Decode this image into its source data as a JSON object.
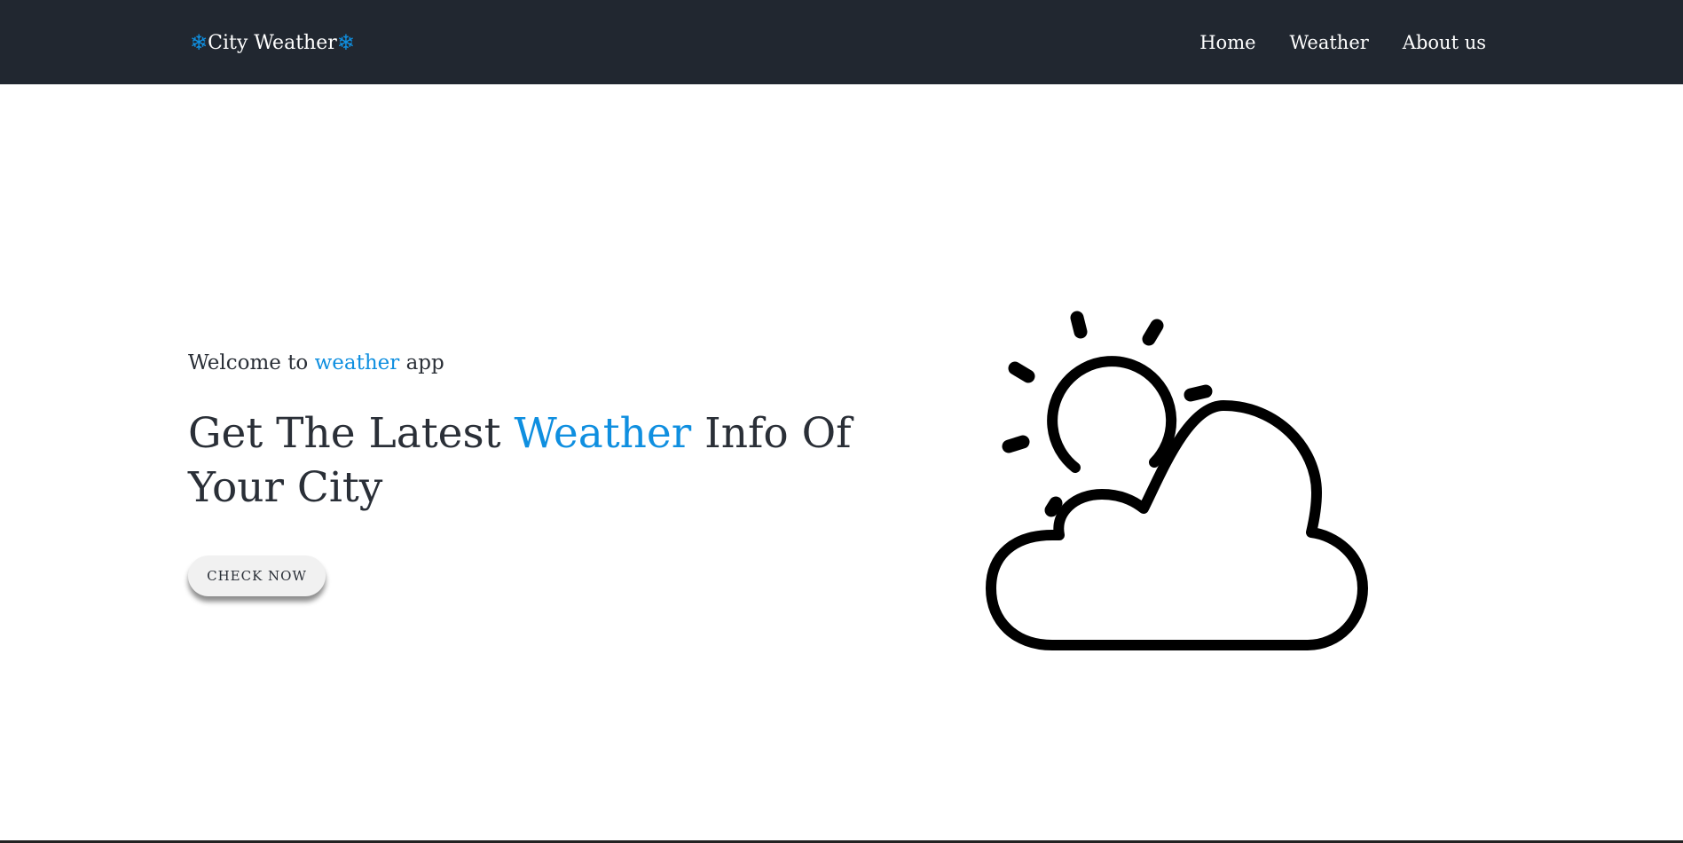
{
  "navbar": {
    "brand_text": "City Weather",
    "brand_icon": "snowflake-icon",
    "brand_icon_glyph": "❄",
    "links": [
      {
        "label": "Home"
      },
      {
        "label": "Weather"
      },
      {
        "label": "About us"
      }
    ]
  },
  "hero": {
    "subtitle_prefix": "Welcome to ",
    "subtitle_accent": "weather",
    "subtitle_suffix": " app",
    "title_prefix": "Get The Latest ",
    "title_accent": "Weather",
    "title_suffix": " Info Of Your City",
    "cta_label": "CHECK NOW",
    "illustration_icon": "partly-cloudy-icon"
  },
  "colors": {
    "navbar_bg": "#212730",
    "accent": "#0f8fe0",
    "text": "#2a2f37",
    "button_bg": "#f1f1f1"
  }
}
